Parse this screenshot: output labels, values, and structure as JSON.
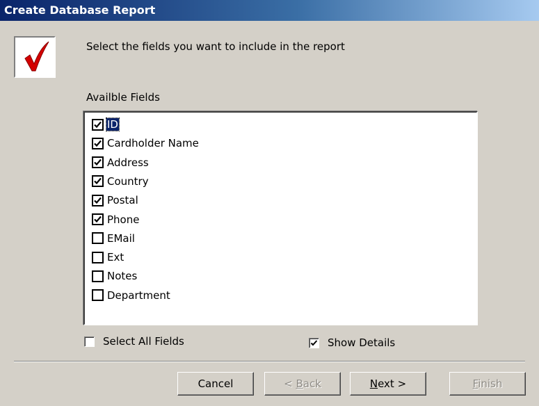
{
  "window": {
    "title": "Create Database Report"
  },
  "header": {
    "icon": "red-checkmark-icon",
    "instruction": "Select the fields you want to include in the report"
  },
  "fields": {
    "label": "Availble Fields",
    "items": [
      {
        "label": "ID",
        "checked": true,
        "selected": true
      },
      {
        "label": "Cardholder Name",
        "checked": true
      },
      {
        "label": "Address",
        "checked": true
      },
      {
        "label": "Country",
        "checked": true
      },
      {
        "label": "Postal",
        "checked": true
      },
      {
        "label": "Phone",
        "checked": true
      },
      {
        "label": "EMail",
        "checked": false
      },
      {
        "label": "Ext",
        "checked": false
      },
      {
        "label": "Notes",
        "checked": false
      },
      {
        "label": "Department",
        "checked": false
      }
    ]
  },
  "options": {
    "select_all": {
      "label": "Select All Fields",
      "checked": false
    },
    "show_details": {
      "label": "Show Details",
      "checked": true
    }
  },
  "buttons": {
    "cancel": {
      "label": "Cancel",
      "enabled": true
    },
    "back": {
      "label": "< Back",
      "mnemonic": "B",
      "enabled": false
    },
    "next": {
      "label": "Next >",
      "mnemonic": "N",
      "enabled": true
    },
    "finish": {
      "label": "Finish",
      "mnemonic": "F",
      "enabled": false
    }
  },
  "colors": {
    "dialog_bg": "#d4d0c8",
    "titlebar_start": "#0a246a",
    "titlebar_end": "#a6caf0",
    "selection": "#0a246a",
    "checkmark_red": "#d40000"
  }
}
